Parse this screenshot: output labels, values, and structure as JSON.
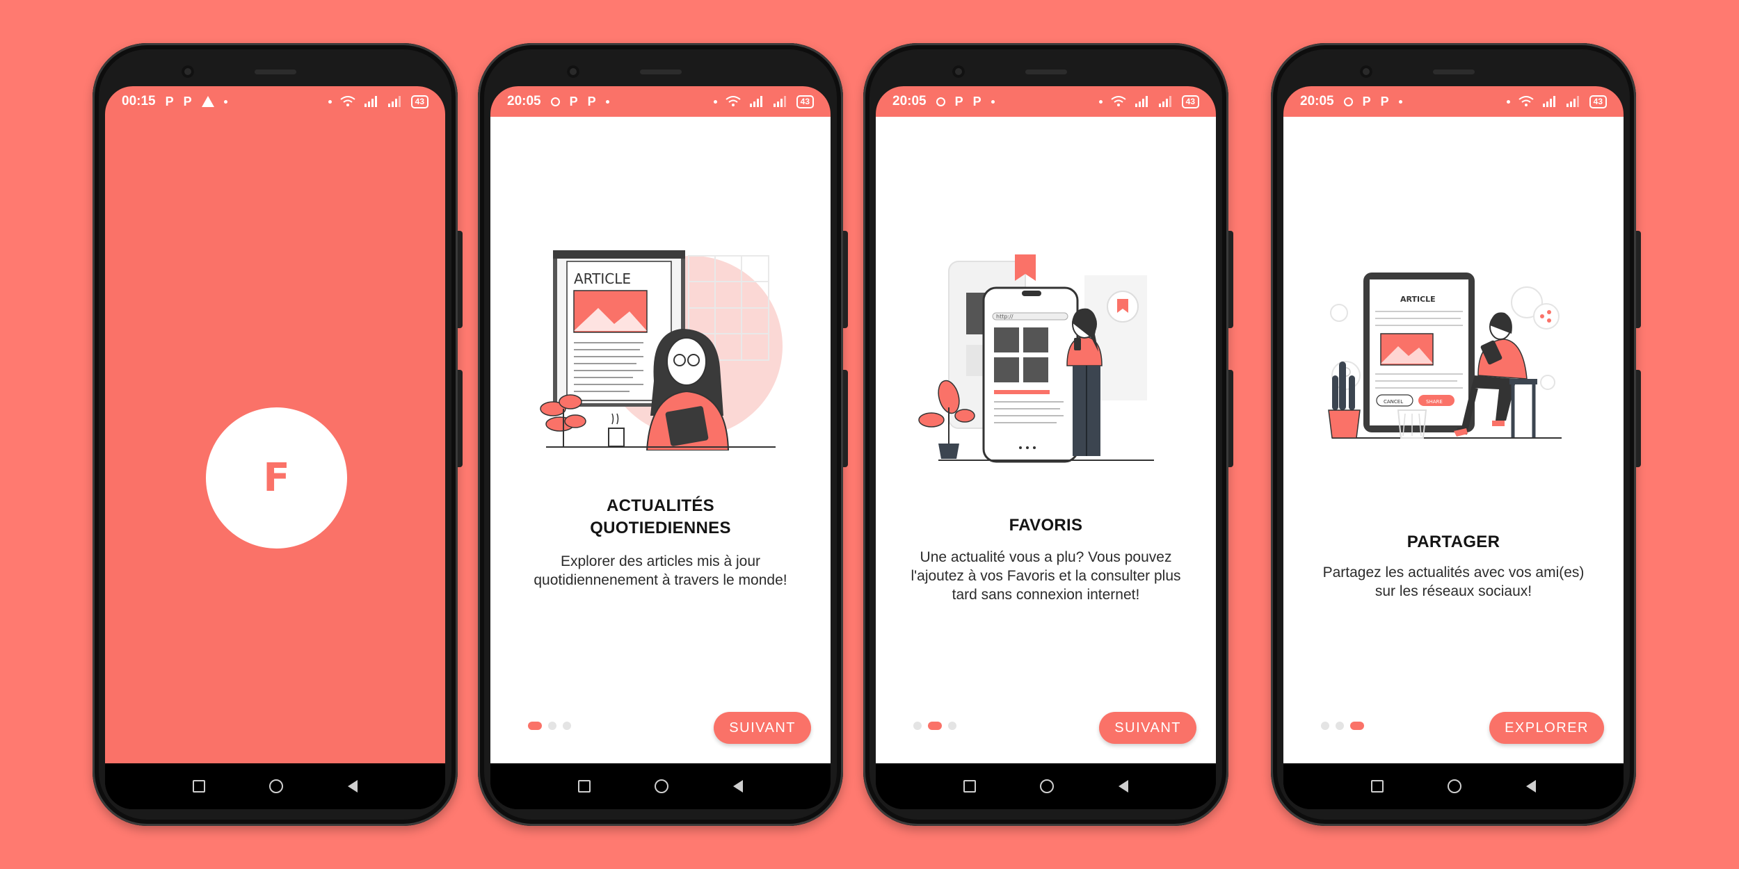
{
  "colors": {
    "background": "#ff7a70",
    "accent": "#fa7268",
    "screen_bg": "#ffffff"
  },
  "screens": [
    {
      "status": {
        "time": "00:15",
        "icons": [
          "P",
          "P"
        ],
        "battery": "43"
      },
      "splash_logo": "F"
    },
    {
      "status": {
        "time": "20:05",
        "icons": [
          "P",
          "P"
        ],
        "battery": "43"
      },
      "illustration_text": "ARTICLE",
      "title": "ACTUALITÉS\nQUOTIEDIENNES",
      "description": "Explorer des articles mis à jour quotidiennenement à travers le monde!",
      "cta_label": "SUIVANT",
      "page_index": 1
    },
    {
      "status": {
        "time": "20:05",
        "icons": [
          "P",
          "P"
        ],
        "battery": "43"
      },
      "illustration_text": "http://",
      "title": "FAVORIS",
      "description": "Une actualité vous a plu? Vous pouvez l'ajoutez à vos Favoris et la consulter plus tard sans connexion internet!",
      "cta_label": "SUIVANT",
      "page_index": 2
    },
    {
      "status": {
        "time": "20:05",
        "icons": [
          "P",
          "P"
        ],
        "battery": "43"
      },
      "illustration_text": "ARTICLE",
      "illustration_buttons": [
        "CANCEL",
        "SHARE"
      ],
      "title": "PARTAGER",
      "description": "Partagez les actualités avec vos ami(es) sur les réseaux sociaux!",
      "cta_label": "EXPLORER",
      "page_index": 3
    }
  ],
  "page_count": 3
}
